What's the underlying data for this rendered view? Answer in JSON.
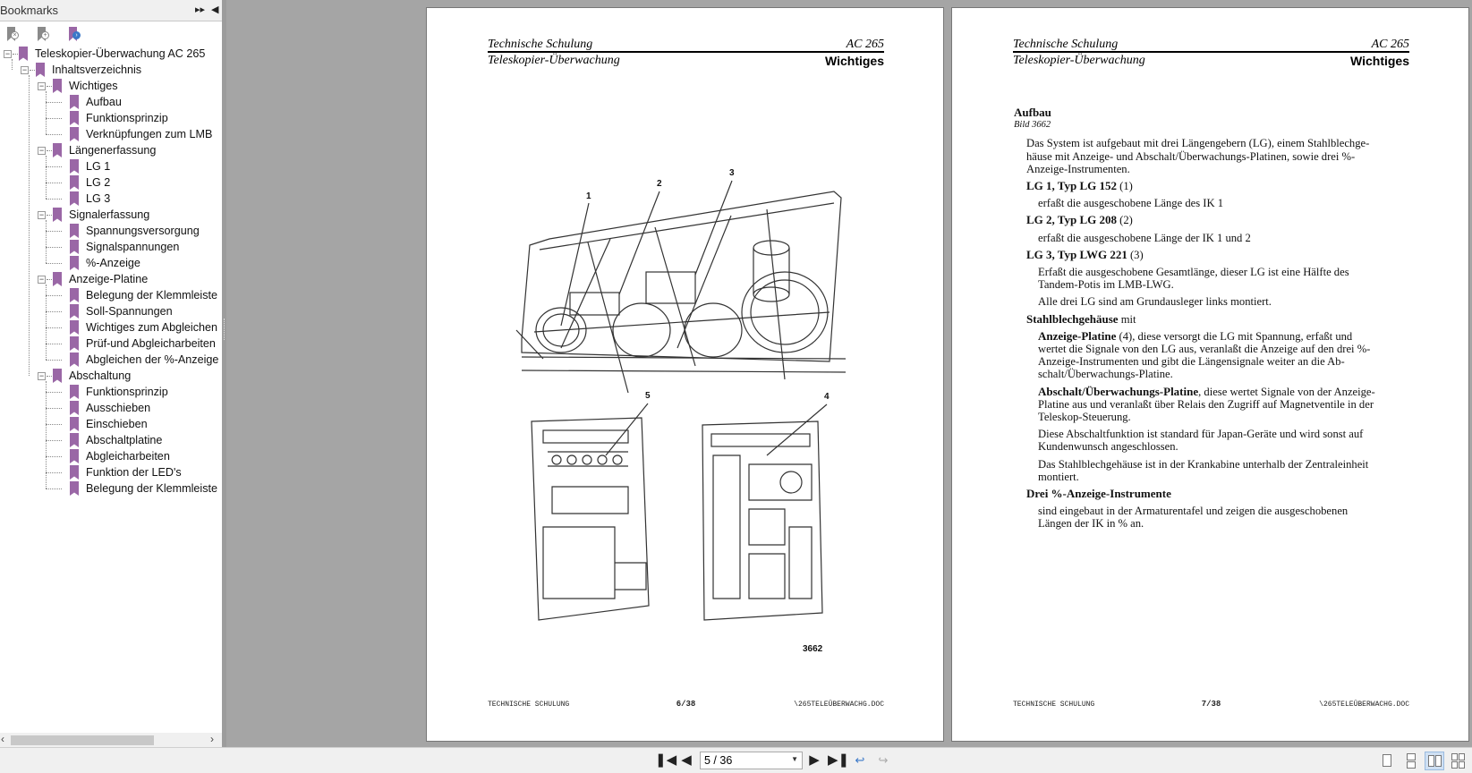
{
  "sidebar": {
    "title": "Bookmarks",
    "header_icons": [
      "expand-panel-icon",
      "collapse-panel-icon"
    ],
    "tools": [
      "delete-bookmark-icon",
      "add-bookmark-icon",
      "go-to-bookmark-icon"
    ],
    "tree": [
      {
        "label": "Teleskopier-Überwachung AC 265",
        "level": 0,
        "expanded": true
      },
      {
        "label": "Inhaltsverzeichnis",
        "level": 1,
        "expanded": true
      },
      {
        "label": "Wichtiges",
        "level": 2,
        "expanded": true
      },
      {
        "label": "Aufbau",
        "level": 3
      },
      {
        "label": "Funktionsprinzip",
        "level": 3
      },
      {
        "label": "Verknüpfungen zum LMB",
        "level": 3
      },
      {
        "label": "Längenerfassung",
        "level": 2,
        "expanded": true
      },
      {
        "label": "LG 1",
        "level": 3
      },
      {
        "label": "LG 2",
        "level": 3
      },
      {
        "label": "LG 3",
        "level": 3
      },
      {
        "label": "Signalerfassung",
        "level": 2,
        "expanded": true
      },
      {
        "label": "Spannungsversorgung",
        "level": 3
      },
      {
        "label": "Signalspannungen",
        "level": 3
      },
      {
        "label": "%-Anzeige",
        "level": 3
      },
      {
        "label": "Anzeige-Platine",
        "level": 2,
        "expanded": true
      },
      {
        "label": "Belegung der Klemmleiste",
        "level": 3
      },
      {
        "label": "Soll-Spannungen",
        "level": 3
      },
      {
        "label": "Wichtiges zum Abgleichen",
        "level": 3
      },
      {
        "label": "Prüf-und Abgleicharbeiten",
        "level": 3
      },
      {
        "label": "Abgleichen der %-Anzeige",
        "level": 3
      },
      {
        "label": "Abschaltung",
        "level": 2,
        "expanded": true
      },
      {
        "label": "Funktionsprinzip",
        "level": 3
      },
      {
        "label": "Ausschieben",
        "level": 3
      },
      {
        "label": "Einschieben",
        "level": 3
      },
      {
        "label": "Abschaltplatine",
        "level": 3
      },
      {
        "label": "Abgleicharbeiten",
        "level": 3
      },
      {
        "label": "Funktion der LED's",
        "level": 3
      },
      {
        "label": "Belegung der Klemmleiste",
        "level": 3
      }
    ]
  },
  "pages": {
    "left": {
      "header_left_1": "Technische Schulung",
      "header_right_1": "AC 265",
      "header_left_2": "Teleskopier-Überwachung",
      "header_right_2": "Wichtiges",
      "figure_labels": {
        "l1": "1",
        "l2": "2",
        "l3": "3",
        "l4": "4",
        "l5": "5",
        "number": "3662"
      },
      "footer_left": "TECHNISCHE SCHULUNG",
      "footer_center": "6/38",
      "footer_right": "\\265TELEÜBERWACHG.DOC"
    },
    "right": {
      "header_left_1": "Technische Schulung",
      "header_right_1": "AC 265",
      "header_left_2": "Teleskopier-Überwachung",
      "header_right_2": "Wichtiges",
      "footer_left": "TECHNISCHE SCHULUNG",
      "footer_center": "7/38",
      "footer_right": "\\265TELEÜBERWACHG.DOC",
      "blocks": [
        {
          "type": "h",
          "text": "Aufbau"
        },
        {
          "type": "cap",
          "text": "Bild 3662"
        },
        {
          "type": "p",
          "indent": 1,
          "lines": [
            "Das System ist aufgebaut mit drei Längengebern (LG), einem Stahlblechge-",
            "häuse mit Anzeige- und Abschalt/Überwachungs-Platinen, sowie drei %-",
            "Anzeige-Instrumenten."
          ]
        },
        {
          "type": "p",
          "indent": 1,
          "bold": "LG 1, Typ LG 152",
          "lines": [
            " (1)"
          ]
        },
        {
          "type": "p",
          "indent": 2,
          "lines": [
            "erfaßt die ausgeschobene Länge des IK 1"
          ]
        },
        {
          "type": "p",
          "indent": 1,
          "bold": "LG 2, Typ LG 208",
          "lines": [
            " (2)"
          ]
        },
        {
          "type": "p",
          "indent": 2,
          "lines": [
            "erfaßt die ausgeschobene Länge der IK 1 und 2"
          ]
        },
        {
          "type": "p",
          "indent": 1,
          "bold": "LG 3, Typ LWG 221",
          "lines": [
            " (3)"
          ]
        },
        {
          "type": "p",
          "indent": 2,
          "lines": [
            "Erfaßt die ausgeschobene Gesamtlänge, dieser LG ist eine Hälfte des",
            "Tandem-Potis im LMB-LWG."
          ]
        },
        {
          "type": "p",
          "indent": 2,
          "lines": [
            "Alle drei LG sind am Grundausleger links montiert."
          ]
        },
        {
          "type": "p",
          "indent": 1,
          "bold": "Stahlblechgehäuse",
          "lines": [
            " mit"
          ]
        },
        {
          "type": "p",
          "indent": 2,
          "bold": "Anzeige-Platine",
          "lines": [
            " (4), diese versorgt die LG mit Spannung, erfaßt und",
            "wertet die Signale von den LG aus, veranlaßt die Anzeige auf den drei %-",
            "Anzeige-Instrumenten und gibt die Längensignale weiter an die  Ab-",
            "schalt/Überwachungs-Platine."
          ]
        },
        {
          "type": "p",
          "indent": 2,
          "bold": "Abschalt/Überwachungs-Platine",
          "lines": [
            ", diese wertet Signale von der Anzeige-",
            "Platine aus und veranlaßt über Relais den Zugriff auf Magnetventile in der",
            "Teleskop-Steuerung."
          ]
        },
        {
          "type": "p",
          "indent": 2,
          "lines": [
            "Diese Abschaltfunktion ist standard für Japan-Geräte und wird sonst auf",
            "Kundenwunsch angeschlossen."
          ]
        },
        {
          "type": "p",
          "indent": 2,
          "lines": [
            "Das Stahlblechgehäuse ist in der Krankabine unterhalb der Zentraleinheit",
            "montiert."
          ]
        },
        {
          "type": "p",
          "indent": 1,
          "bold": "Drei %-Anzeige-Instrumente",
          "lines": [
            ""
          ]
        },
        {
          "type": "p",
          "indent": 2,
          "lines": [
            "sind eingebaut in der Armaturentafel und zeigen die ausgeschobenen",
            "Längen der IK in % an."
          ]
        }
      ]
    }
  },
  "toolbar": {
    "page_value": "5 / 36",
    "icons": [
      "first-page-icon",
      "previous-page-icon",
      "next-page-icon",
      "last-page-icon",
      "previous-view-icon",
      "next-view-icon"
    ],
    "view_modes": [
      "single-page",
      "continuous",
      "facing",
      "continuous-facing"
    ],
    "active_view": "facing"
  },
  "colors": {
    "bookmark": "#9a67a6",
    "background": "#a5a5a5",
    "active_view": "#cfe0f3"
  }
}
